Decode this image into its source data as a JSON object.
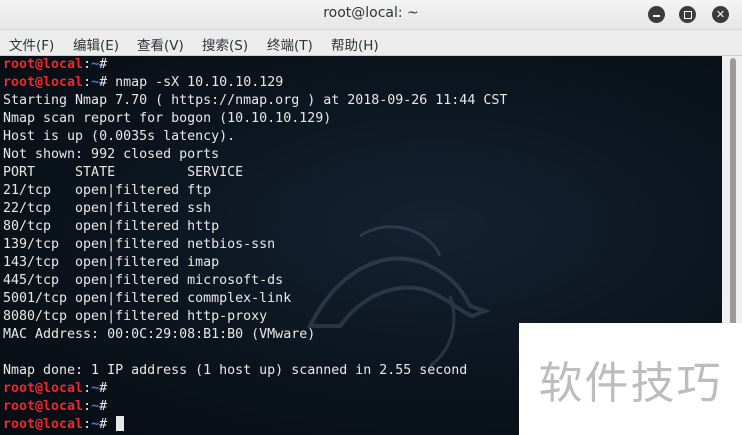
{
  "window": {
    "title": "root@local: ~"
  },
  "menu": [
    {
      "label": "文件(F)"
    },
    {
      "label": "编辑(E)"
    },
    {
      "label": "查看(V)"
    },
    {
      "label": "搜索(S)"
    },
    {
      "label": "终端(T)"
    },
    {
      "label": "帮助(H)"
    }
  ],
  "prompt": {
    "user": "root@local",
    "sep": ":",
    "path": "~",
    "symbol": "# "
  },
  "terminal": {
    "lines": [
      {
        "type": "prompt",
        "cmd": ""
      },
      {
        "type": "prompt",
        "cmd": "nmap -sX 10.10.10.129"
      },
      {
        "type": "out",
        "text": "Starting Nmap 7.70 ( https://nmap.org ) at 2018-09-26 11:44 CST"
      },
      {
        "type": "out",
        "text": "Nmap scan report for bogon (10.10.10.129)"
      },
      {
        "type": "out",
        "text": "Host is up (0.0035s latency)."
      },
      {
        "type": "out",
        "text": "Not shown: 992 closed ports"
      },
      {
        "type": "out",
        "text": "PORT     STATE         SERVICE"
      },
      {
        "type": "out",
        "text": "21/tcp   open|filtered ftp"
      },
      {
        "type": "out",
        "text": "22/tcp   open|filtered ssh"
      },
      {
        "type": "out",
        "text": "80/tcp   open|filtered http"
      },
      {
        "type": "out",
        "text": "139/tcp  open|filtered netbios-ssn"
      },
      {
        "type": "out",
        "text": "143/tcp  open|filtered imap"
      },
      {
        "type": "out",
        "text": "445/tcp  open|filtered microsoft-ds"
      },
      {
        "type": "out",
        "text": "5001/tcp open|filtered commplex-link"
      },
      {
        "type": "out",
        "text": "8080/tcp open|filtered http-proxy"
      },
      {
        "type": "out",
        "text": "MAC Address: 00:0C:29:08:B1:B0 (VMware)"
      },
      {
        "type": "out",
        "text": ""
      },
      {
        "type": "out",
        "text": "Nmap done: 1 IP address (1 host up) scanned in 2.55 second"
      },
      {
        "type": "prompt",
        "cmd": ""
      },
      {
        "type": "prompt",
        "cmd": ""
      },
      {
        "type": "prompt",
        "cmd": "",
        "cursor": true
      }
    ]
  },
  "watermark": {
    "text": "软件技巧"
  },
  "colors": {
    "prompt_user": "#ef2929",
    "prompt_path": "#3f7ed8",
    "terminal_text": "#e8e8e8",
    "terminal_bg": "#0b141d"
  }
}
